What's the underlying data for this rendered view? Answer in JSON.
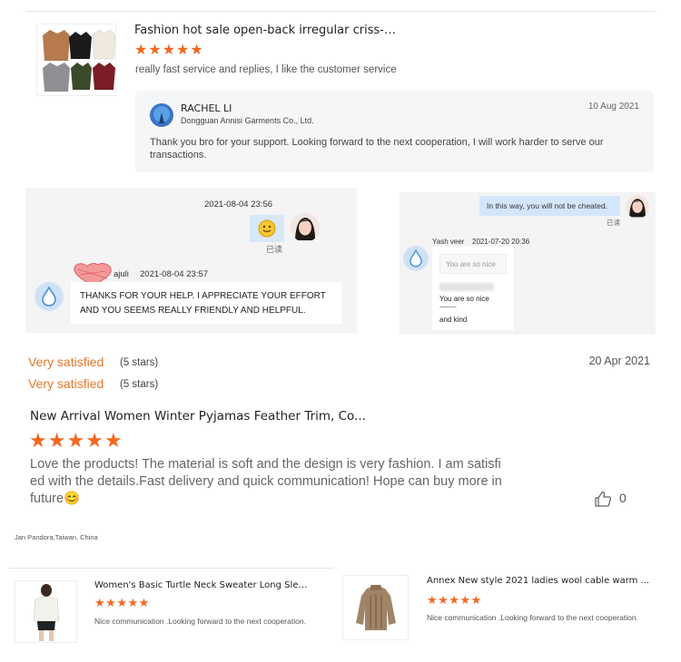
{
  "review1": {
    "product_title": "Fashion hot sale open-back irregular criss-cros...",
    "rating": 5,
    "comment": "really fast service and replies, I like the customer service",
    "reply": {
      "name": "RACHEL LI",
      "company": "Dongguan Annisi Garments Co., Ltd.",
      "date": "10 Aug 2021",
      "text": "Thank you bro for your support. Looking forward to the next cooperation, I will work harder to serve our transactions."
    }
  },
  "chat_left": {
    "timestamp1": "2021-08-04 23:56",
    "read_status": "已读",
    "sender_suffix": "ajuli",
    "timestamp2": "2021-08-04 23:57",
    "message": "THANKS FOR YOUR HELP. I APPRECIATE YOUR EFFORT AND YOU SEEMS REALLY FRIENDLY AND HELPFUL."
  },
  "chat_right": {
    "message1": "In this way, you will not be cheated.",
    "read_status": "已读",
    "sender": "Yash veer",
    "timestamp": "2021-07-20 20:36",
    "quoted": "You are so nice",
    "line1": "You are so nice",
    "separator": "--------",
    "line2": "and kind"
  },
  "ratings": {
    "line1_label": "Very satisfied",
    "line1_stars": "(5 stars)",
    "line2_label": "Very satisfied",
    "line2_stars": "(5 stars)",
    "date": "20 Apr 2021"
  },
  "review2": {
    "product_title": "New Arrival Women Winter Pyjamas Feather Trim, Co...",
    "rating": 5,
    "comment_l1": "Love the products! The material is soft and the design is very fashion. I am satisfi",
    "comment_l2": "ed with the details.Fast delivery and quick communication! Hope can buy more in",
    "comment_l3": "future",
    "emoji": "😊",
    "likes": "0"
  },
  "reviewer_footer": "Jan Pandora,Taiwan, China",
  "products": [
    {
      "title": "Women's Basic Turtle Neck Sweater Long Slee...",
      "rating": 5,
      "comment": "Nice communication .Looking forward to the next cooperation."
    },
    {
      "title": "Annex New style 2021 ladies wool cable warm ...",
      "rating": 5,
      "comment": "Nice communication .Looking forward to the next cooperation."
    }
  ],
  "colors": {
    "star": "#f2681f",
    "satisfied": "#e8762b",
    "reply_bg": "#f5f6f8",
    "chat_bg": "#f4f4f4",
    "chat_sent_bubble": "#d4e6fb"
  },
  "icons": {
    "star": "★",
    "thumbs_up": "thumbs-up-icon",
    "smiley": "smiley-icon",
    "avatar_placeholder": "water-drop-avatar-icon",
    "heart": "heart-sticker-icon"
  }
}
